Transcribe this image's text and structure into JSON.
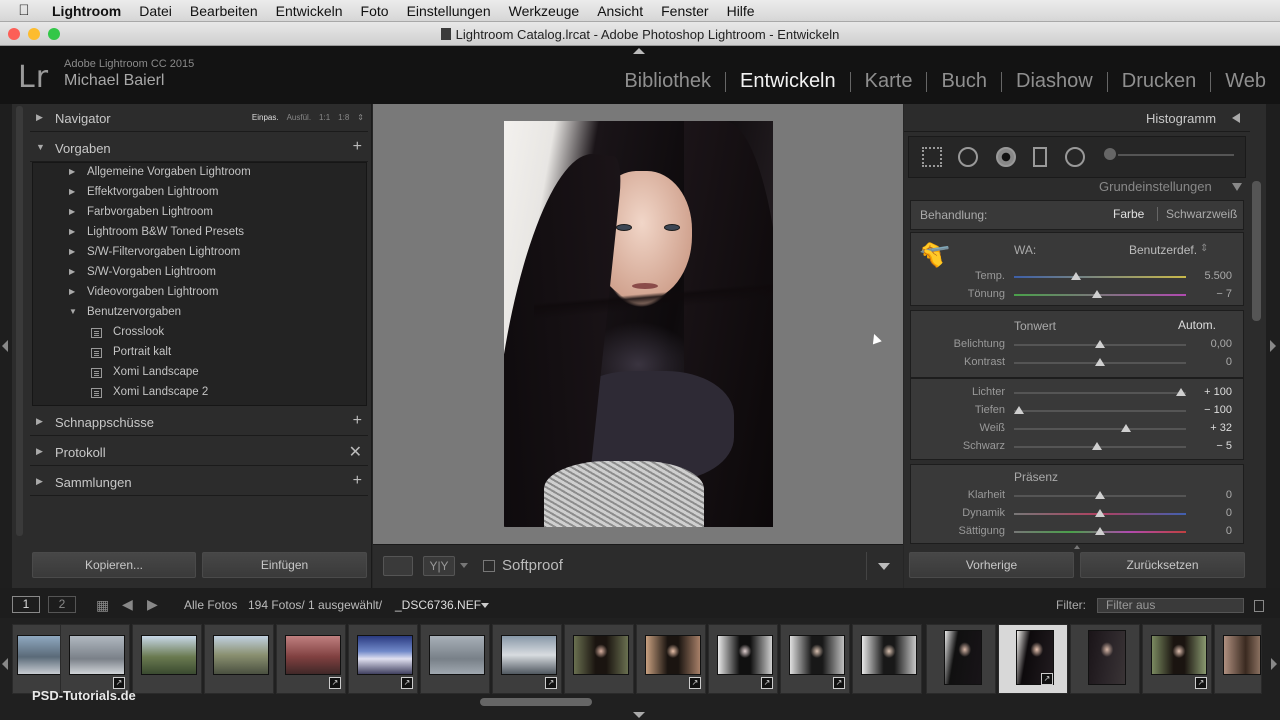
{
  "menubar": {
    "app": "Lightroom",
    "items": [
      "Datei",
      "Bearbeiten",
      "Entwickeln",
      "Foto",
      "Einstellungen",
      "Werkzeuge",
      "Ansicht",
      "Fenster",
      "Hilfe"
    ]
  },
  "window": {
    "title": "Lightroom Catalog.lrcat - Adobe Photoshop Lightroom - Entwickeln"
  },
  "identity": {
    "logo": "Lr",
    "product": "Adobe Lightroom CC 2015",
    "owner": "Michael Baierl"
  },
  "modules": [
    {
      "label": "Bibliothek",
      "active": false
    },
    {
      "label": "Entwickeln",
      "active": true
    },
    {
      "label": "Karte",
      "active": false
    },
    {
      "label": "Buch",
      "active": false
    },
    {
      "label": "Diashow",
      "active": false
    },
    {
      "label": "Drucken",
      "active": false
    },
    {
      "label": "Web",
      "active": false
    }
  ],
  "left_panel": {
    "navigator": {
      "label": "Navigator",
      "options": [
        "Einpas.",
        "Ausfül.",
        "1:1",
        "1:8"
      ],
      "active_option": "Einpas."
    },
    "presets": {
      "label": "Vorgaben",
      "folders": [
        "Allgemeine Vorgaben Lightroom",
        "Effektvorgaben Lightroom",
        "Farbvorgaben Lightroom",
        "Lightroom B&W Toned Presets",
        "S/W-Filtervorgaben Lightroom",
        "S/W-Vorgaben Lightroom",
        "Videovorgaben Lightroom",
        "Benutzervorgaben"
      ],
      "user_presets": [
        "Crosslook",
        "Portrait kalt",
        "Xomi Landscape",
        "Xomi Landscape 2"
      ]
    },
    "snapshots": "Schnappschüsse",
    "history": "Protokoll",
    "collections": "Sammlungen",
    "copy_button": "Kopieren...",
    "paste_button": "Einfügen"
  },
  "toolbar": {
    "softproof": "Softproof",
    "view_mode": "Y|Y"
  },
  "right_panel": {
    "histogram": "Histogramm",
    "basic": "Grundeinstellungen",
    "treatment_label": "Behandlung:",
    "treatment_color": "Farbe",
    "treatment_bw": "Schwarzweiß",
    "wb_label": "WA:",
    "wb_value": "Benutzerdef.",
    "tone_label": "Tonwert",
    "auto_label": "Autom.",
    "presence_label": "Präsenz",
    "sliders": [
      {
        "label": "Temp.",
        "value": "5.500",
        "pos": 0.36
      },
      {
        "label": "Tönung",
        "value": "− 7",
        "pos": 0.48
      },
      {
        "label": "Belichtung",
        "value": "0,00",
        "pos": 0.5
      },
      {
        "label": "Kontrast",
        "value": "0",
        "pos": 0.5
      },
      {
        "label": "Lichter",
        "value": "+ 100",
        "pos": 0.97
      },
      {
        "label": "Tiefen",
        "value": "− 100",
        "pos": 0.03
      },
      {
        "label": "Weiß",
        "value": "+ 32",
        "pos": 0.65
      },
      {
        "label": "Schwarz",
        "value": "− 5",
        "pos": 0.48
      },
      {
        "label": "Klarheit",
        "value": "0",
        "pos": 0.5
      },
      {
        "label": "Dynamik",
        "value": "0",
        "pos": 0.5
      },
      {
        "label": "Sättigung",
        "value": "0",
        "pos": 0.5
      }
    ],
    "previous_button": "Vorherige",
    "reset_button": "Zurücksetzen"
  },
  "filmbar": {
    "view1": "1",
    "view2": "2",
    "source": "Alle Fotos",
    "count": "194 Fotos/ 1 ausgewählt/",
    "filename": "_DSC6736.NEF",
    "filter_label": "Filter:",
    "filter_value": "Filter aus"
  },
  "watermark": "PSD-Tutorials.de",
  "colors": {
    "accent": "#f2f2f2",
    "panel": "#2c2c2c",
    "section": "#393939"
  }
}
